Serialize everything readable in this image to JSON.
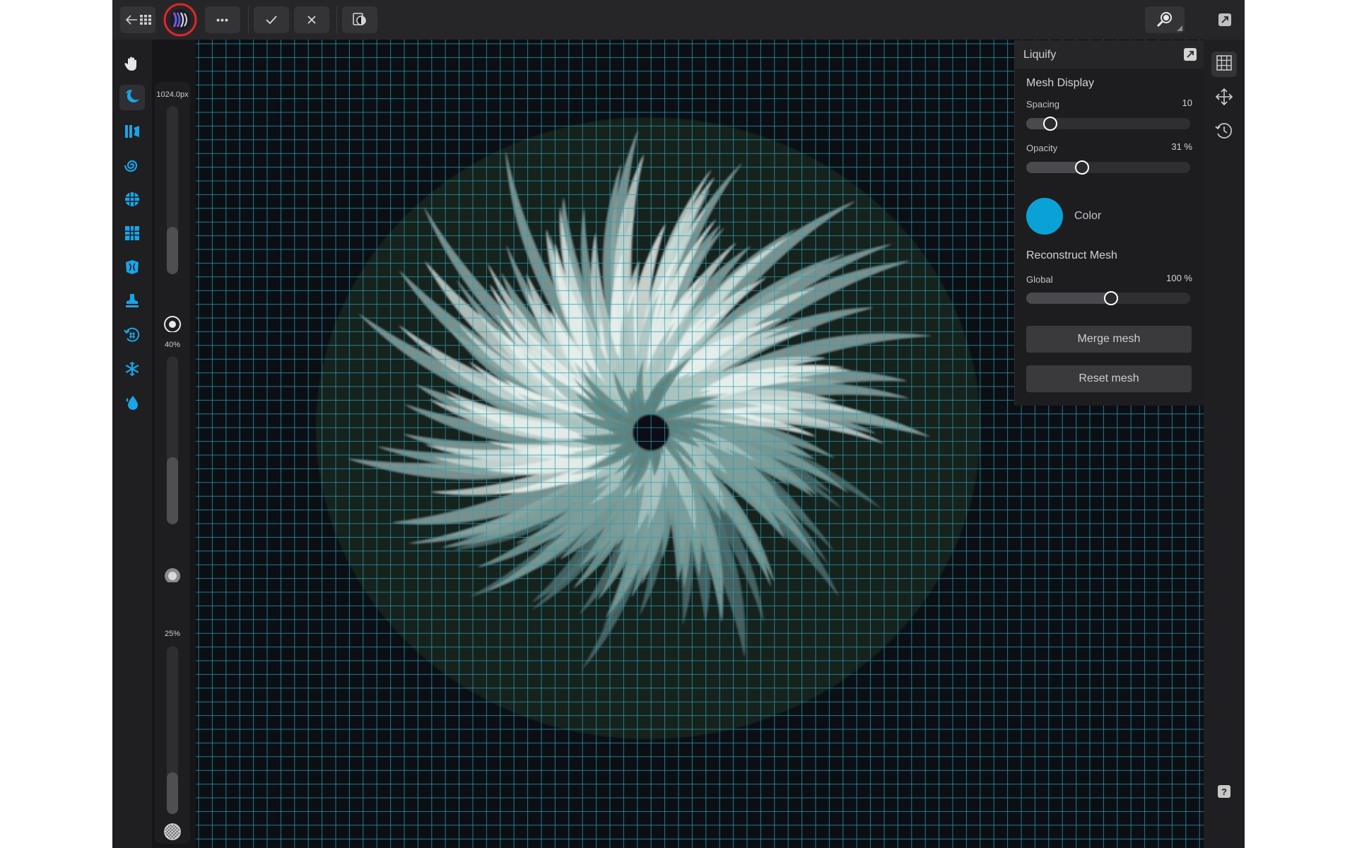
{
  "toolbar": {
    "more_label": "•••",
    "accent_color": "#e0262b"
  },
  "brush": {
    "size_value": "1024.0px",
    "size_level": 0.28,
    "strength_value": "40%",
    "strength_level": 0.4,
    "hardness_value": "25%",
    "hardness_level": 0.25
  },
  "panel": {
    "title": "Liquify",
    "mesh_display_title": "Mesh Display",
    "spacing_label": "Spacing",
    "spacing_value": "10",
    "spacing_level": 0.14,
    "opacity_label": "Opacity",
    "opacity_value": "31 %",
    "opacity_level": 0.33,
    "color_label": "Color",
    "color_value": "#0aa1d6",
    "reconstruct_title": "Reconstruct Mesh",
    "global_label": "Global",
    "global_value": "100 %",
    "global_level": 0.51,
    "merge_label": "Merge mesh",
    "reset_label": "Reset mesh"
  },
  "studio": {
    "help_label": "?"
  },
  "colors": {
    "tool_icon": "#1aa4e8",
    "mesh_line": "#2a9fb7",
    "canvas_bg": "#0b0f14"
  }
}
